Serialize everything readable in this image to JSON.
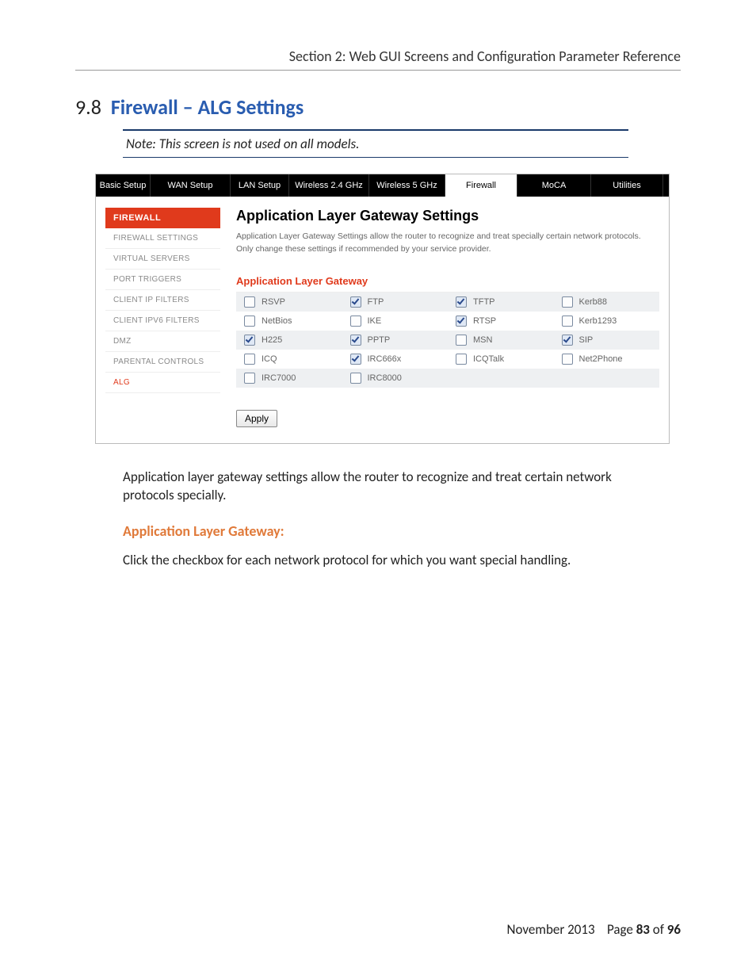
{
  "running_head": "Section 2:  Web GUI Screens and Configuration Parameter Reference",
  "heading_num": "9.8",
  "heading_title": "Firewall – ALG Settings",
  "note": "Note:  This screen is not used on all models.",
  "body_para": "Application layer gateway settings allow the router to recognize and treat certain network protocols specially.",
  "sub_heading": "Application Layer Gateway:",
  "instruction": "Click the checkbox for each network protocol for which you want special handling.",
  "footer": {
    "date": "November 2013",
    "page_label": "Page",
    "page": "83",
    "of_label": "of",
    "total": "96"
  },
  "gui": {
    "tabs": [
      "Basic Setup",
      "WAN Setup",
      "LAN Setup",
      "Wireless 2.4 GHz",
      "Wireless 5 GHz",
      "Firewall",
      "MoCA",
      "Utilities"
    ],
    "active_tab_index": 5,
    "sidebar_head": "FIREWALL",
    "sidebar_items": [
      "FIREWALL SETTINGS",
      "VIRTUAL SERVERS",
      "PORT TRIGGERS",
      "CLIENT IP FILTERS",
      "CLIENT IPV6 FILTERS",
      "DMZ",
      "PARENTAL CONTROLS",
      "ALG"
    ],
    "sidebar_active_index": 7,
    "main_title": "Application Layer Gateway Settings",
    "main_desc": "Application Layer Gateway Settings allow the router to recognize and treat specially certain network protocols. Only change these settings if recommended by your service provider.",
    "main_subtitle": "Application Layer Gateway",
    "alg_rows": [
      [
        {
          "label": "RSVP",
          "checked": false
        },
        {
          "label": "FTP",
          "checked": true
        },
        {
          "label": "TFTP",
          "checked": true
        },
        {
          "label": "Kerb88",
          "checked": false
        }
      ],
      [
        {
          "label": "NetBios",
          "checked": false
        },
        {
          "label": "IKE",
          "checked": false
        },
        {
          "label": "RTSP",
          "checked": true
        },
        {
          "label": "Kerb1293",
          "checked": false
        }
      ],
      [
        {
          "label": "H225",
          "checked": true
        },
        {
          "label": "PPTP",
          "checked": true
        },
        {
          "label": "MSN",
          "checked": false
        },
        {
          "label": "SIP",
          "checked": true
        }
      ],
      [
        {
          "label": "ICQ",
          "checked": false
        },
        {
          "label": "IRC666x",
          "checked": true
        },
        {
          "label": "ICQTalk",
          "checked": false
        },
        {
          "label": "Net2Phone",
          "checked": false
        }
      ],
      [
        {
          "label": "IRC7000",
          "checked": false
        },
        {
          "label": "IRC8000",
          "checked": false
        }
      ]
    ],
    "apply_label": "Apply"
  }
}
